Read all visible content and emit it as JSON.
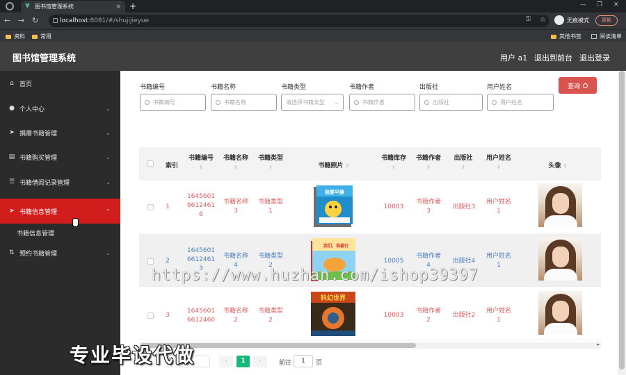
{
  "browser": {
    "tab_title": "图书馆管理系统",
    "tab_close": "×",
    "new_tab": "+",
    "url_host": "localhost",
    "url_path": ":8081/#/shujijieyue",
    "incognito_label": "无痕模式",
    "update_label": "更新",
    "bookmarks": [
      {
        "label": "资料"
      },
      {
        "label": "常用"
      },
      {
        "label": "其他书签"
      },
      {
        "label": "阅读清单"
      }
    ]
  },
  "header": {
    "title": "图书馆管理系统",
    "user": "用户 a1",
    "back_link": "退出到前台",
    "logout_link": "退出登录"
  },
  "sidebar": {
    "items": [
      {
        "label": "首页",
        "icon": "home-icon"
      },
      {
        "label": "个人中心",
        "icon": "user-icon"
      },
      {
        "label": "捐赠书籍管理",
        "icon": "send-icon"
      },
      {
        "label": "书籍购买管理",
        "icon": "clipboard-icon"
      },
      {
        "label": "书籍借阅记录管理",
        "icon": "list-icon"
      },
      {
        "label": "书籍信息管理",
        "icon": "send-icon"
      },
      {
        "label": "预约书籍管理",
        "icon": "sort-icon"
      }
    ],
    "sub_item": "书籍信息管理"
  },
  "filters": {
    "book_no": {
      "label": "书籍编号",
      "placeholder": "书籍编号"
    },
    "book_name": {
      "label": "书籍名称",
      "placeholder": "书籍名称"
    },
    "book_type": {
      "label": "书籍类型",
      "placeholder": "请选择书籍类型"
    },
    "author": {
      "label": "书籍作者",
      "placeholder": "书籍作者"
    },
    "publisher": {
      "label": "出版社",
      "placeholder": "出版社"
    },
    "user_name": {
      "label": "用户姓名",
      "placeholder": "用户姓名"
    },
    "query_label": "查询"
  },
  "table": {
    "columns": [
      "索引",
      "书籍编号",
      "书籍名称",
      "书籍类型",
      "书籍照片",
      "书籍库存",
      "书籍作者",
      "出版社",
      "用户姓名",
      "头像"
    ],
    "sort_glyph": "⇕",
    "rows": [
      {
        "index": "1",
        "book_no": [
          "1645601",
          "6612461",
          "6"
        ],
        "name": [
          "书籍名称",
          "3"
        ],
        "type": [
          "书籍类型",
          "1"
        ],
        "stock": "10003",
        "author": [
          "书籍作者",
          "3"
        ],
        "publisher": "出版社3",
        "user": [
          "用户姓名",
          "1"
        ],
        "cover_text": "我要平静"
      },
      {
        "index": "2",
        "book_no": [
          "1645601",
          "6612461",
          "3"
        ],
        "name": [
          "书籍名称",
          "4"
        ],
        "type": [
          "书籍类型",
          "2"
        ],
        "stock": "10005",
        "author": [
          "书籍作者",
          "4"
        ],
        "publisher": "出版社4",
        "user": [
          "用户姓名",
          "1"
        ],
        "cover_text": "我们，谁最行"
      },
      {
        "index": "3",
        "book_no": [
          "1645601",
          "6612460"
        ],
        "name": [
          "书籍名称",
          "2"
        ],
        "type": [
          "书籍类型",
          "2"
        ],
        "stock": "10003",
        "author": [
          "书籍作者",
          "2"
        ],
        "publisher": "出版社2",
        "user": [
          "用户姓名",
          "1"
        ],
        "cover_text": "科幻世界"
      }
    ]
  },
  "pagination": {
    "current": "1",
    "goto_label": "前往",
    "goto_value": "1",
    "page_label": "页"
  },
  "watermark": {
    "url": "https://www.huzhan.com/ishop39397",
    "slogan": "专业毕设代做"
  },
  "colors": {
    "sidebar_active": "#d21d1d",
    "query_button": "#d9534f",
    "pager_active": "#17b978",
    "link_red": "#e25b5b",
    "link_blue": "#4a7fc1"
  }
}
